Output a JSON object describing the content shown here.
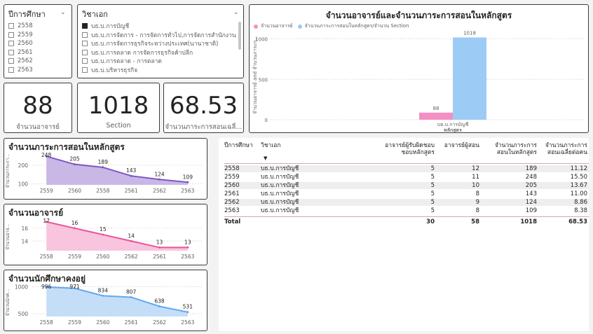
{
  "year_slicer": {
    "title": "ปีการศึกษา",
    "options": [
      "2558",
      "2559",
      "2560",
      "2561",
      "2562",
      "2563"
    ]
  },
  "major_slicer": {
    "title": "วิชาเอก",
    "options": [
      {
        "label": "บธ.บ.การบัญชี",
        "checked": true
      },
      {
        "label": "บธ.บ.การจัดการ - การจัดการทั่วไป,การจัดการสำนักงาน",
        "checked": false
      },
      {
        "label": "บธ.บ.การจัดการธุรกิจระหว่างประเทศ(นานาชาติ)",
        "checked": false
      },
      {
        "label": "บธ.บ.การตลาด การจัดการธุรกิจค้าปลีก",
        "checked": false
      },
      {
        "label": "บธ.บ.การตลาด - การตลาด",
        "checked": false
      },
      {
        "label": "บธ.บ.บริหารธุรกิจ",
        "checked": false
      }
    ]
  },
  "kpis": [
    {
      "value": "88",
      "label": "จำนวนอาจารย์"
    },
    {
      "value": "1018",
      "label": "Section"
    },
    {
      "value": "68.53",
      "label": "จำนวนภาระการสอนเฉลี่..."
    }
  ],
  "main_chart": {
    "title": "จำนวนอาจารย์และจำนวนภาระการสอนในหลักสูตร",
    "legend": [
      "จำนวนอาจารย์",
      "จำนวนภาระการสอนในหลักสูตร/จำนวน Section"
    ],
    "colors": {
      "teachers": "#f48fc4",
      "sections": "#9ccbf6"
    },
    "ylabel": "จำนวนอาจารย์ and จำนวนภาระก...",
    "ticks": [
      "0",
      "500",
      "1000"
    ],
    "category": "บธ.บ.การบัญชี",
    "xlabel": "หลักสูตร",
    "value_labels": [
      "88",
      "1018"
    ]
  },
  "line_charts": [
    {
      "title": "จำนวนภาระการสอนในหลักสูตร",
      "ylabel": "จำนวนภาระกา...",
      "ticks": [
        "200",
        "100"
      ],
      "color": "#7e57c2",
      "fill": "#c9b7e6",
      "x": [
        "2559",
        "2560",
        "2558",
        "2561",
        "2562",
        "2563"
      ],
      "labels": [
        "248",
        "205",
        "189",
        "143",
        "124",
        "109"
      ]
    },
    {
      "title": "จำนวนอาจารย์",
      "ylabel": "จำนวนอาจ...",
      "ticks": [
        "16",
        "14"
      ],
      "color": "#e9559a",
      "fill": "#f9c4dd",
      "x": [
        "2558",
        "2559",
        "2560",
        "2562",
        "2561",
        "2563"
      ],
      "labels": [
        "17",
        "16",
        "15",
        "14",
        "13",
        "13"
      ]
    },
    {
      "title": "จำนวนนักศึกษาคงอยู่",
      "ylabel": "จำนวนนักศ...",
      "ticks": [
        "1000",
        "500"
      ],
      "color": "#64a8ee",
      "fill": "#c4def8",
      "x": [
        "2558",
        "2559",
        "2560",
        "2561",
        "2562",
        "2563"
      ],
      "labels": [
        "996",
        "971",
        "834",
        "807",
        "638",
        "531"
      ]
    }
  ],
  "chart_data": [
    {
      "type": "bar",
      "title": "จำนวนอาจารย์และจำนวนภาระการสอนในหลักสูตร",
      "categories": [
        "บธ.บ.การบัญชี"
      ],
      "series": [
        {
          "name": "จำนวนอาจารย์",
          "values": [
            88
          ]
        },
        {
          "name": "จำนวนภาระการสอนในหลักสูตร/จำนวน Section",
          "values": [
            1018
          ]
        }
      ],
      "xlabel": "หลักสูตร",
      "ylabel": "จำนวนอาจารย์ and จำนวนภาระก...",
      "ylim": [
        0,
        1100
      ]
    },
    {
      "type": "area",
      "title": "จำนวนภาระการสอนในหลักสูตร",
      "x": [
        "2559",
        "2560",
        "2558",
        "2561",
        "2562",
        "2563"
      ],
      "values": [
        248,
        205,
        189,
        143,
        124,
        109
      ],
      "ylim": [
        95,
        260
      ]
    },
    {
      "type": "area",
      "title": "จำนวนอาจารย์",
      "x": [
        "2558",
        "2559",
        "2560",
        "2562",
        "2561",
        "2563"
      ],
      "values": [
        17,
        16,
        15,
        14,
        13,
        13
      ],
      "ylim": [
        12.5,
        17.3
      ]
    },
    {
      "type": "area",
      "title": "จำนวนนักศึกษาคงอยู่",
      "x": [
        "2558",
        "2559",
        "2560",
        "2561",
        "2562",
        "2563"
      ],
      "values": [
        996,
        971,
        834,
        807,
        638,
        531
      ],
      "ylim": [
        450,
        1020
      ]
    }
  ],
  "table": {
    "headers": [
      "ปีการศึกษา",
      "วิชาเอก",
      "อาจารย์ผู้รับผิดชอบหลักสูตร",
      "อาจารย์ผู้สอน",
      "จำนวนภาระการสอนในหลักสูตร",
      "จำนวนภาระการสอนเฉลี่ยต่อคน"
    ],
    "header_lines": [
      [
        "ปีการศึกษา"
      ],
      [
        "วิชาเอก"
      ],
      [
        "อาจารย์ผู้รับผิดชอบ",
        "ชอบหลักสูตร"
      ],
      [
        "อาจารย์ผู้สอน"
      ],
      [
        "จำนวนภาระการ",
        "สอนในหลักสูตร"
      ],
      [
        "จำนวนภาระการ",
        "สอนเฉลี่ยต่อคน"
      ]
    ],
    "rows": [
      [
        "2558",
        "บธ.บ.การบัญชี",
        "5",
        "12",
        "189",
        "11.12"
      ],
      [
        "2559",
        "บธ.บ.การบัญชี",
        "5",
        "11",
        "248",
        "15.50"
      ],
      [
        "2560",
        "บธ.บ.การบัญชี",
        "5",
        "10",
        "205",
        "13.67"
      ],
      [
        "2561",
        "บธ.บ.การบัญชี",
        "5",
        "8",
        "143",
        "11.00"
      ],
      [
        "2562",
        "บธ.บ.การบัญชี",
        "5",
        "9",
        "124",
        "8.86"
      ],
      [
        "2563",
        "บธ.บ.การบัญชี",
        "5",
        "8",
        "109",
        "8.38"
      ]
    ],
    "total": [
      "Total",
      "",
      "30",
      "58",
      "1018",
      "68.53"
    ]
  }
}
